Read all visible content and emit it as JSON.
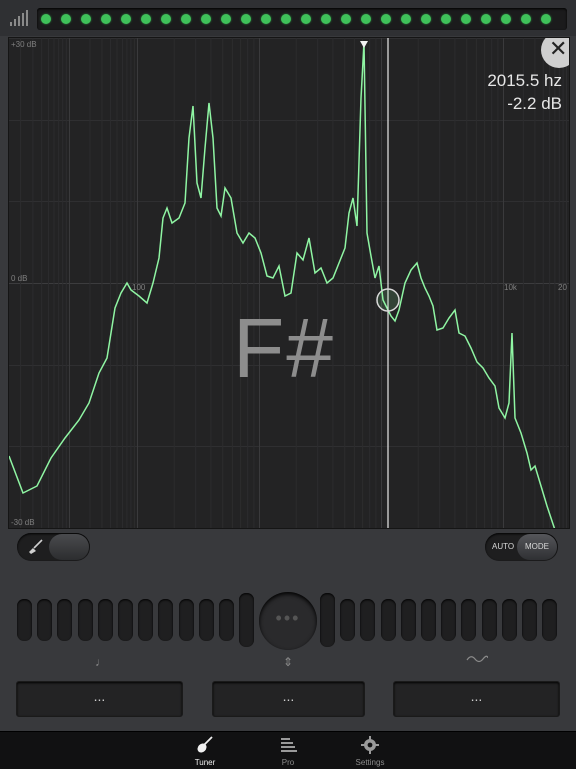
{
  "status": {
    "signal_icon": "signal-bars-icon",
    "led_count": 26,
    "led_color": "#3fc15a"
  },
  "spectrum": {
    "db_top_label": "+30 dB",
    "db_mid_label": "0 dB",
    "db_bottom_label": "-30 dB",
    "freq_label_100": "100",
    "freq_label_10k": "10k",
    "freq_label_20k": "20",
    "readout_freq": "2015.5 hz",
    "readout_db": "-2.2 dB",
    "note": "F#",
    "trace_color": "#8ff5a3",
    "close_icon": "close-icon"
  },
  "controls": {
    "brush_icon": "brush-icon",
    "mode_auto": "AUTO",
    "mode_label": "MODE"
  },
  "tuner": {
    "center_dots": "•••"
  },
  "selectors": {
    "icons": [
      "note-icon",
      "up-down-arrows-icon",
      "wave-icon"
    ],
    "values": [
      "...",
      "...",
      "..."
    ]
  },
  "tabs": [
    {
      "label": "Tuner",
      "icon": "guitar-icon",
      "active": true
    },
    {
      "label": "Pro",
      "icon": "bars-icon",
      "active": false
    },
    {
      "label": "Settings",
      "icon": "gear-icon",
      "active": false
    }
  ]
}
